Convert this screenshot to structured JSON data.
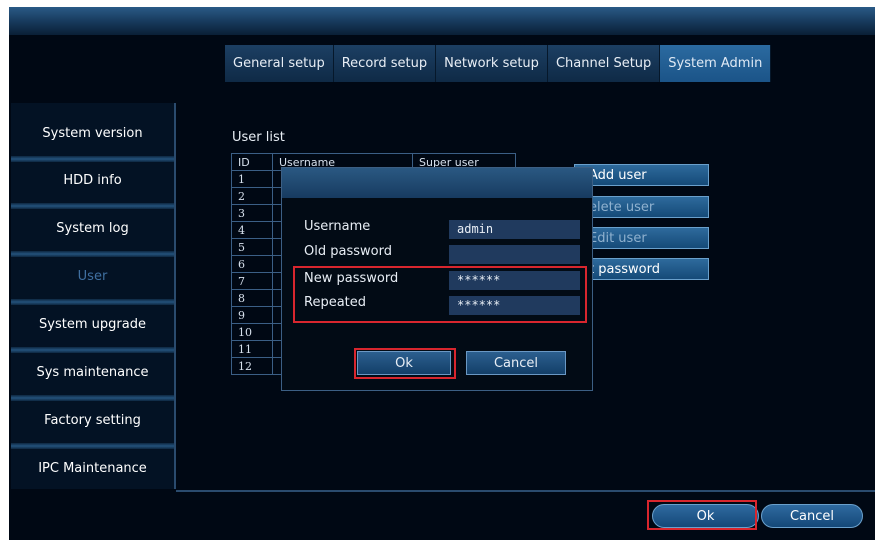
{
  "tabs": [
    "General setup",
    "Record setup",
    "Network setup",
    "Channel Setup",
    "System Admin"
  ],
  "sidebar": [
    "System version",
    "HDD info",
    "System log",
    "User",
    "System upgrade",
    "Sys maintenance",
    "Factory setting",
    "IPC Maintenance"
  ],
  "user_list": {
    "label": "User list",
    "headers": [
      "ID",
      "Username",
      "Super user"
    ],
    "rows": [
      "1",
      "2",
      "3",
      "4",
      "5",
      "6",
      "7",
      "8",
      "9",
      "10",
      "11",
      "12"
    ]
  },
  "right_buttons": [
    "Add user",
    "elete user",
    "Edit user",
    "t password"
  ],
  "dialog": {
    "fields": [
      {
        "label": "Username",
        "value": "admin"
      },
      {
        "label": "Old password",
        "value": ""
      },
      {
        "label": "New password",
        "value": "******"
      },
      {
        "label": "Repeated",
        "value": "******"
      }
    ],
    "ok": "Ok",
    "cancel": "Cancel"
  },
  "footer": {
    "ok": "Ok",
    "cancel": "Cancel"
  },
  "colors": {
    "highlight": "#d8262e",
    "active_tab": "#1b5488",
    "background": "#000814"
  }
}
